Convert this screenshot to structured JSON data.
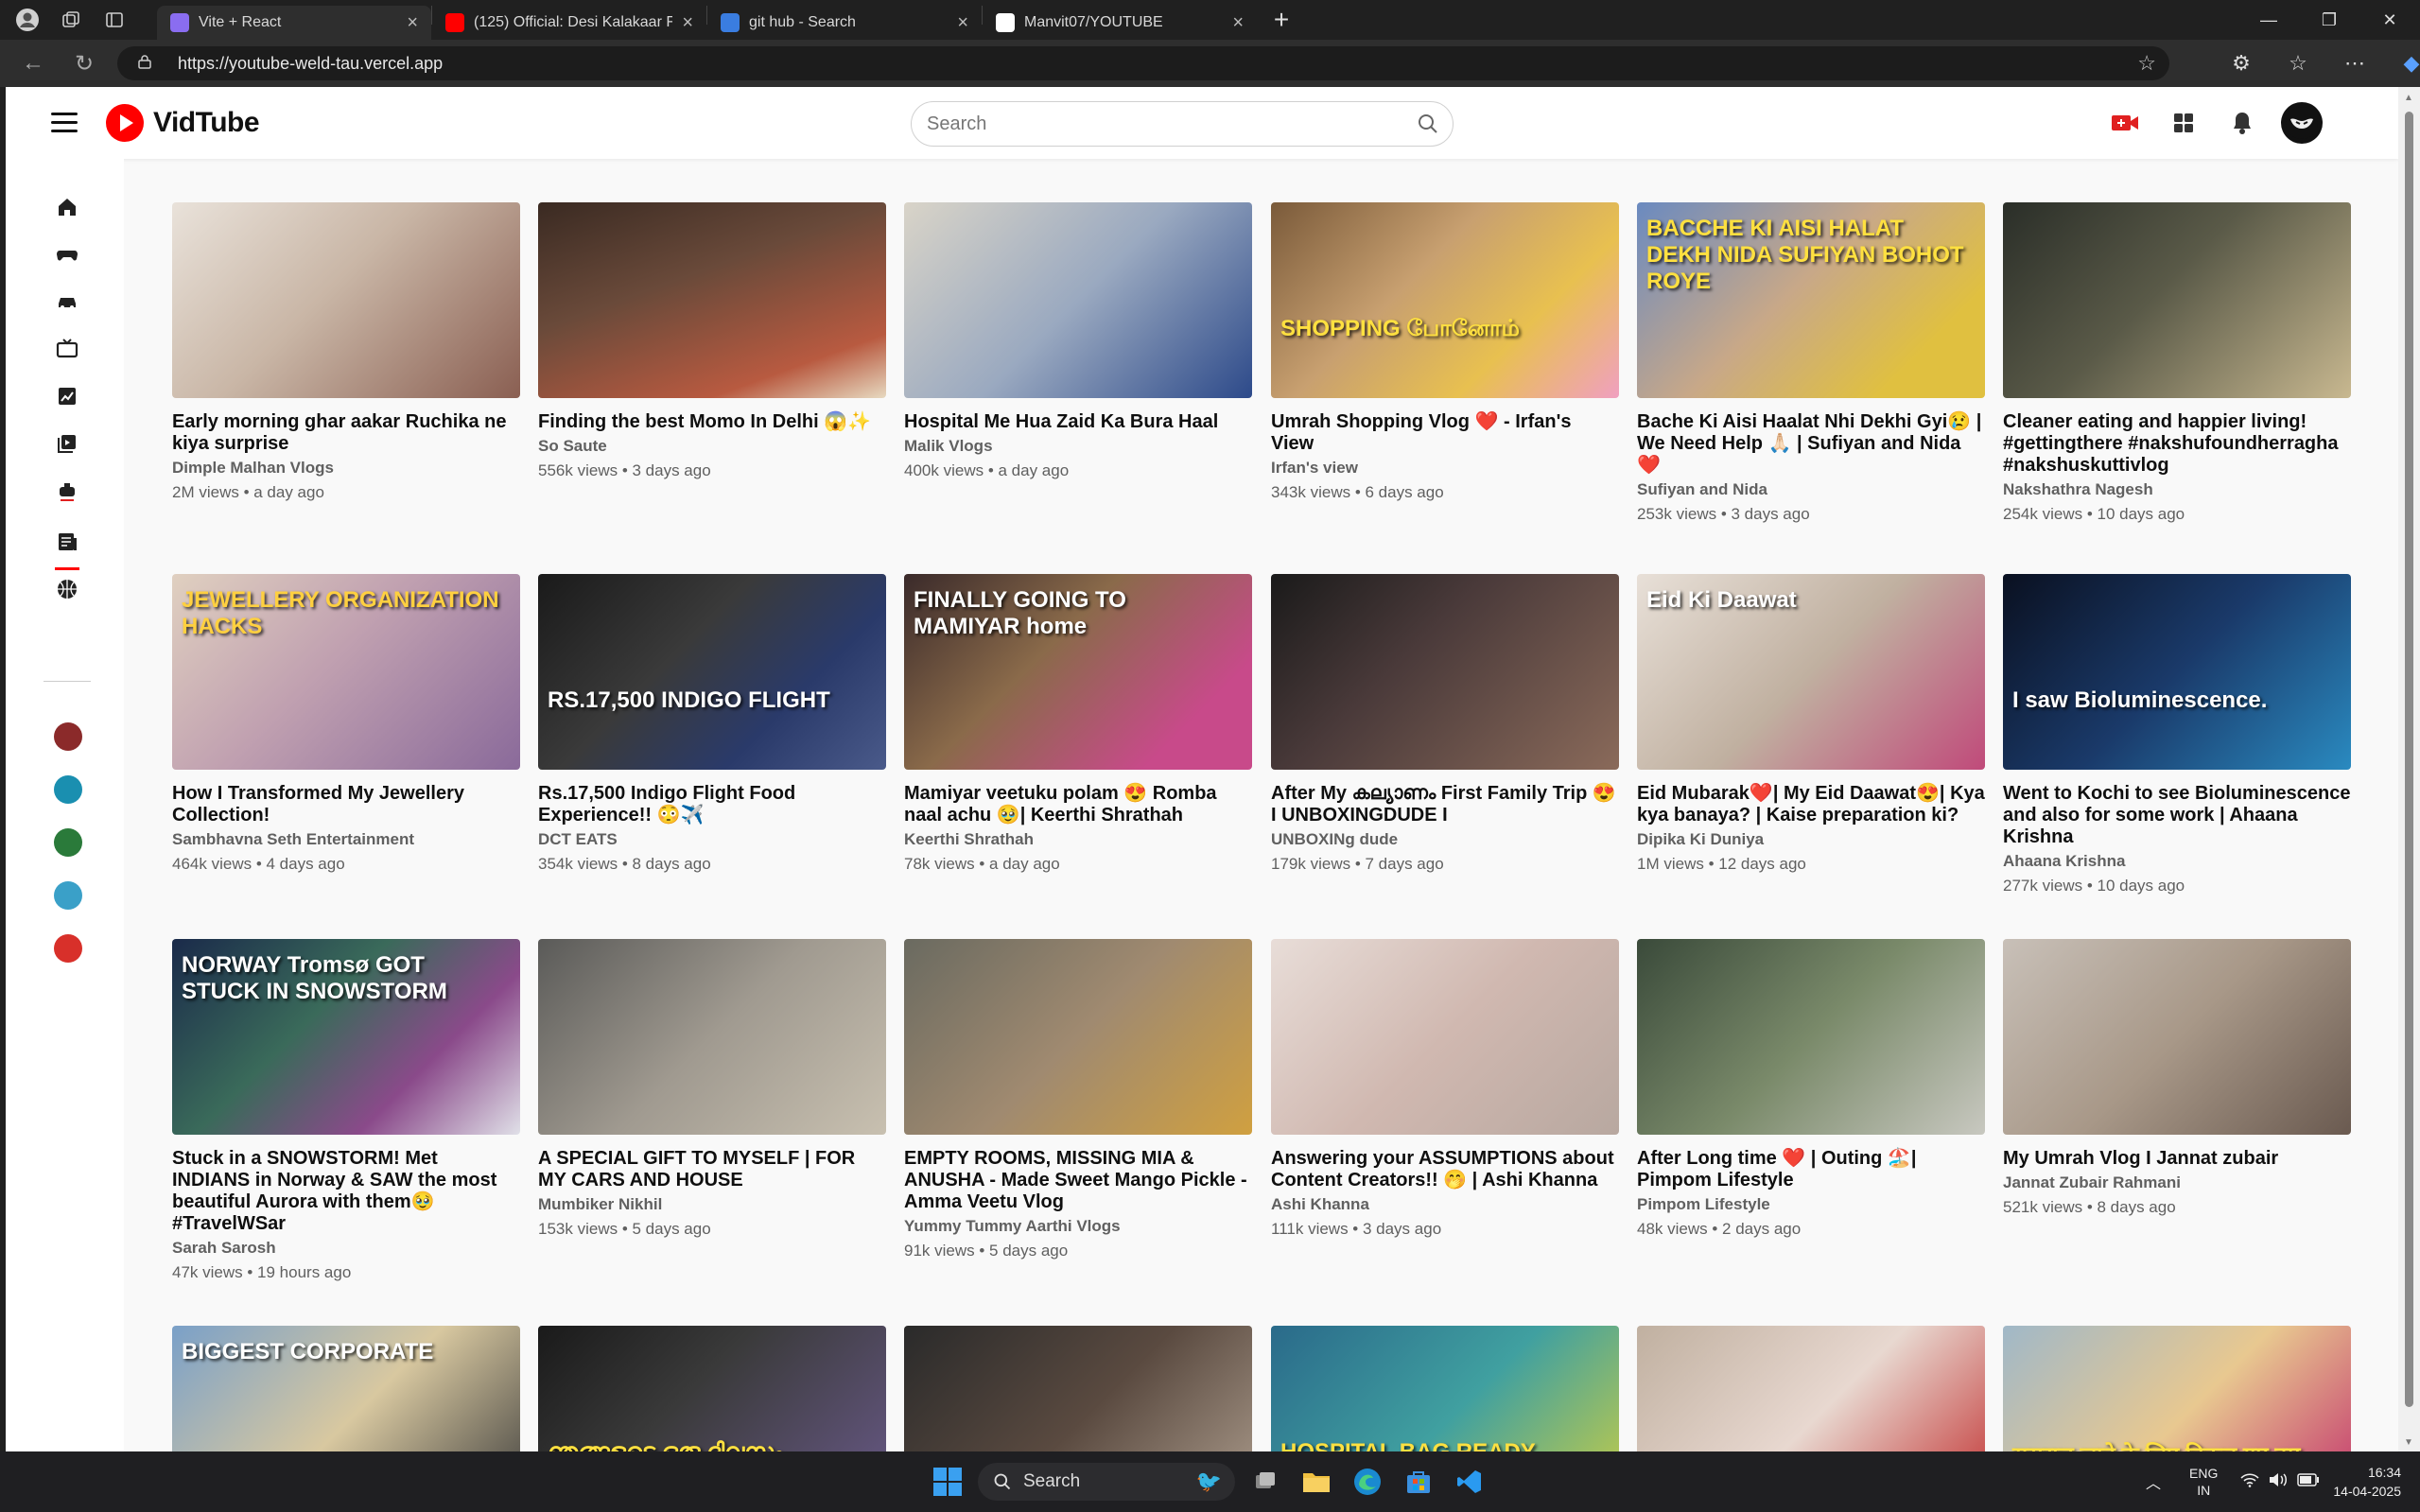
{
  "browser": {
    "tabs": [
      {
        "title": "Vite + React",
        "fav": "#8a6df0",
        "active": true
      },
      {
        "title": "(125) Official: Desi Kalakaar F",
        "fav": "#ff0000",
        "active": false
      },
      {
        "title": "git hub - Search",
        "fav": "#3a7de0",
        "active": false
      },
      {
        "title": "Manvit07/YOUTUBE",
        "fav": "#ffffff",
        "active": false
      }
    ],
    "url": "https://youtube-weld-tau.vercel.app"
  },
  "app": {
    "name": "VidTube",
    "search_placeholder": "Search"
  },
  "sidebar": {
    "icons": [
      "home-icon",
      "gaming-icon",
      "cars-icon",
      "tv-icon",
      "art-icon",
      "library-icon",
      "podcast-icon",
      "news-icon",
      "sports-icon"
    ],
    "channel_colors": [
      "#8b2a2a",
      "#1a8fb0",
      "#2a7a3a",
      "#3aa0c8",
      "#d8302a"
    ]
  },
  "videos": [
    {
      "title": "Early morning ghar aakar Ruchika ne kiya surprise",
      "channel": "Dimple Malhan Vlogs",
      "meta": "2M views • a day ago",
      "bg": "linear-gradient(135deg,#e9e2da,#c9b6a6 45%,#8a5f52)"
    },
    {
      "title": "Finding the best Momo In Delhi 😱✨",
      "channel": "So Saute",
      "meta": "556k views • 3 days ago",
      "bg": "linear-gradient(160deg,#3a2a22,#6a4a3a 40%,#b85a40 80%,#e7d9c0)"
    },
    {
      "title": "Hospital Me Hua Zaid Ka Bura Haal",
      "channel": "Malik Vlogs",
      "meta": "400k views • a day ago",
      "bg": "linear-gradient(135deg,#d9d4c8,#9aa9c0 50%,#2d4a8a)"
    },
    {
      "title": "Umrah Shopping Vlog ❤️ - Irfan's View",
      "channel": "Irfan's view",
      "meta": "343k views • 6 days ago",
      "bg": "linear-gradient(135deg,#7a5a3a,#c8a070 40%,#e8c050 70%,#f0a0c0)"
    },
    {
      "title": "Bache Ki Aisi Haalat Nhi Dekhi Gyi😢 | We Need Help 🙏🏻 | Sufiyan and Nida ❤️",
      "channel": "Sufiyan and Nida",
      "meta": "253k views • 3 days ago",
      "bg": "linear-gradient(135deg,#6a8ac0,#c8a888 45%,#e0c040 80%)"
    },
    {
      "title": "Cleaner eating and happier living! #gettingthere #nakshufoundherragha #nakshuskuttivlog",
      "channel": "Nakshathra Nagesh",
      "meta": "254k views • 10 days ago",
      "bg": "linear-gradient(135deg,#2a2e28,#5a5a48 45%,#c8b890)"
    },
    {
      "title": "How I Transformed My Jewellery Collection!",
      "channel": "Sambhavna Seth Entertainment",
      "meta": "464k views • 4 days ago",
      "bg": "linear-gradient(135deg,#e0d0c0,#c0a0b0 45%,#8a6a9a)"
    },
    {
      "title": "Rs.17,500 Indigo Flight Food Experience!! 😳✈️",
      "channel": "DCT EATS",
      "meta": "354k views • 8 days ago",
      "bg": "linear-gradient(135deg,#1a1a1a,#3a3a3a 40%,#2a3a6a 70%,#4a5a8a)"
    },
    {
      "title": "Mamiyar veetuku polam 😍 Romba naal achu 🥹| Keerthi Shrathah",
      "channel": "Keerthi Shrathah",
      "meta": "78k views • a day ago",
      "bg": "linear-gradient(135deg,#3a2a2a,#8a6a4a 40%,#c84a8a 80%)"
    },
    {
      "title": "After My കല്യാണം First Family Trip 😍 I UNBOXINGDUDE I",
      "channel": "UNBOXINg dude",
      "meta": "179k views • 7 days ago",
      "bg": "linear-gradient(135deg,#1a1a1a,#4a3a3a 40%,#8a6a5a)"
    },
    {
      "title": "Eid Mubarak❤️| My Eid Daawat😍| Kya kya banaya? | Kaise preparation ki?",
      "channel": "Dipika Ki Duniya",
      "meta": "1M views • 12 days ago",
      "bg": "linear-gradient(135deg,#e8e0d8,#c0b0a0 50%,#c04a7a)"
    },
    {
      "title": "Went to Kochi to see Bioluminescence and also for some work | Ahaana Krishna",
      "channel": "Ahaana Krishna",
      "meta": "277k views • 10 days ago",
      "bg": "linear-gradient(135deg,#0a1020,#1a3a6a 50%,#2a8ac0)"
    },
    {
      "title": "Stuck in a SNOWSTORM! Met INDIANS in Norway & SAW the most beautiful Aurora with them🥹 #TravelWSar",
      "channel": "Sarah Sarosh",
      "meta": "47k views • 19 hours ago",
      "bg": "linear-gradient(135deg,#1a2a4a,#3a6a5a 40%,#8a4a8a 70%,#e0e0e8)"
    },
    {
      "title": "A SPECIAL GIFT TO MYSELF | FOR MY CARS AND HOUSE",
      "channel": "Mumbiker Nikhil",
      "meta": "153k views • 5 days ago",
      "bg": "linear-gradient(135deg,#5a5a58,#a09a90 50%,#c8c0b0)"
    },
    {
      "title": "EMPTY ROOMS, MISSING MIA & ANUSHA - Made Sweet Mango Pickle - Amma Veetu Vlog",
      "channel": "Yummy Tummy Aarthi Vlogs",
      "meta": "91k views • 5 days ago",
      "bg": "linear-gradient(135deg,#6a6a60,#a08a70 50%,#d0a040)"
    },
    {
      "title": "Answering your ASSUMPTIONS about Content Creators!! 🤭 | Ashi Khanna",
      "channel": "Ashi Khanna",
      "meta": "111k views • 3 days ago",
      "bg": "linear-gradient(135deg,#e8ddd8,#d0b8b0 50%,#b8a8a0)"
    },
    {
      "title": "After Long time ❤️ | Outing 🏖️| Pimpom Lifestyle",
      "channel": "Pimpom Lifestyle",
      "meta": "48k views • 2 days ago",
      "bg": "linear-gradient(135deg,#3a4a3a,#7a8a6a 50%,#c8c8c0)"
    },
    {
      "title": "My Umrah Vlog I Jannat zubair",
      "channel": "Jannat Zubair Rahmani",
      "meta": "521k views • 8 days ago",
      "bg": "linear-gradient(135deg,#c8c0b8,#a89888 50%,#6a5a50)"
    },
    {
      "title": "",
      "channel": "",
      "meta": "",
      "bg": "linear-gradient(135deg,#7aa0c8,#d8c8a0 50%,#3a3a3a)"
    },
    {
      "title": "",
      "channel": "",
      "meta": "",
      "bg": "linear-gradient(135deg,#1a1a1a,#3a3a3a 40%,#6a5a8a)"
    },
    {
      "title": "",
      "channel": "",
      "meta": "",
      "bg": "linear-gradient(135deg,#2a2a2a,#5a4a40 50%,#b0a090)"
    },
    {
      "title": "",
      "channel": "",
      "meta": "",
      "bg": "linear-gradient(135deg,#2a6a8a,#40a0a0 50%,#d0d040)"
    },
    {
      "title": "",
      "channel": "",
      "meta": "",
      "bg": "linear-gradient(135deg,#c0b0a0,#e8d8d0 50%,#c02a2a)"
    },
    {
      "title": "",
      "channel": "",
      "meta": "",
      "bg": "linear-gradient(135deg,#a0b8c8,#e8c890 50%,#c02a6a)"
    }
  ],
  "thumb_overlays": [
    {
      "index": 3,
      "text": "SHOPPING போனோம்",
      "color": "#ffe040"
    },
    {
      "index": 4,
      "text": "BACCHE KI AISI HALAT DEKH NIDA SUFIYAN BOHOT ROYE",
      "color": "#ffe040"
    },
    {
      "index": 6,
      "text": "JEWELLERY ORGANIZATION HACKS",
      "color": "#ffd040"
    },
    {
      "index": 7,
      "text": "RS.17,500 INDIGO FLIGHT",
      "color": "#ffffff"
    },
    {
      "index": 8,
      "text": "FINALLY GOING TO MAMIYAR home",
      "color": "#ffffff"
    },
    {
      "index": 10,
      "text": "Eid Ki Daawat",
      "color": "#ffffff"
    },
    {
      "index": 11,
      "text": "I saw Bioluminescence.",
      "color": "#ffffff"
    },
    {
      "index": 12,
      "text": "NORWAY Tromsø GOT STUCK IN SNOWSTORM",
      "color": "#ffffff"
    },
    {
      "index": 18,
      "text": "BIGGEST CORPORATE",
      "color": "#ffffff"
    },
    {
      "index": 19,
      "text": "ഞങ്ങളുടെ ഒരു ദിവസം",
      "color": "#ffe040"
    },
    {
      "index": 21,
      "text": "HOSPITAL BAG READY... LEKIN ANDAR KYA HAI?",
      "color": "#ffe040"
    },
    {
      "index": 23,
      "text": "ससुराल जाने के लिए निकल गए हम",
      "color": "#ffe040"
    }
  ],
  "taskbar": {
    "search": "Search",
    "lang_line1": "ENG",
    "lang_line2": "IN",
    "time": "16:34",
    "date": "14-04-2025"
  }
}
